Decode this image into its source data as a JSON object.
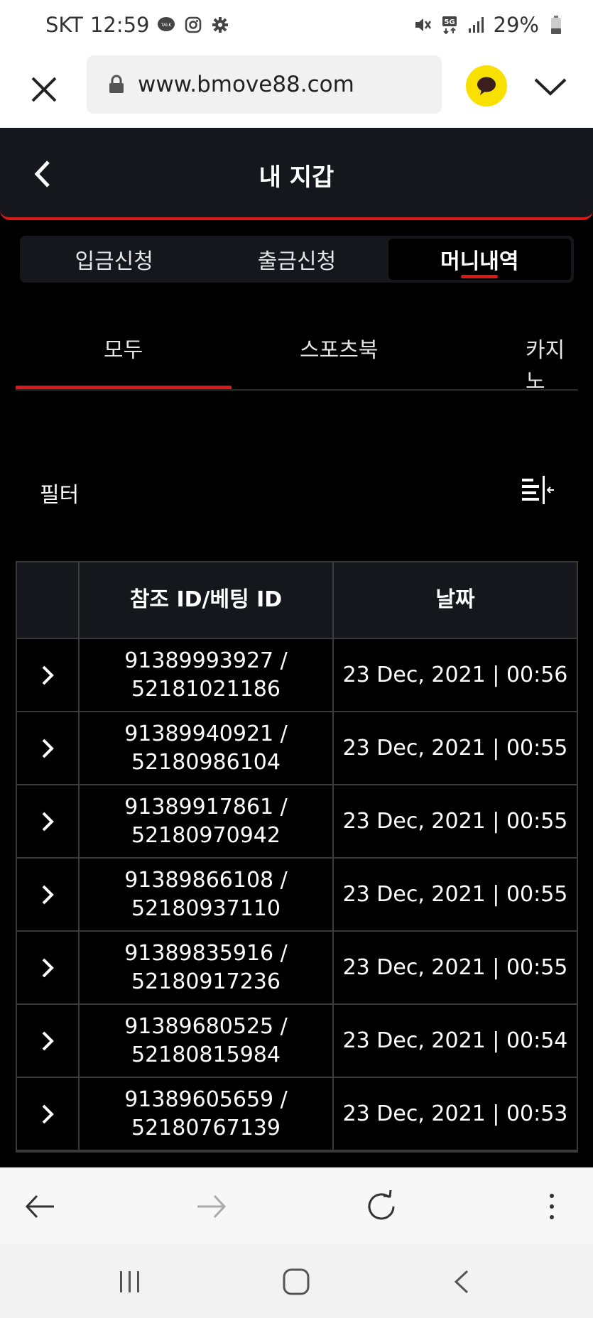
{
  "status_bar": {
    "carrier": "SKT",
    "time": "12:59",
    "network": "5G",
    "battery": "29%"
  },
  "browser": {
    "url": "www.bmove88.com"
  },
  "header": {
    "title": "내 지갑"
  },
  "segment_tabs": [
    {
      "label": "입금신청",
      "active": false
    },
    {
      "label": "출금신청",
      "active": false
    },
    {
      "label": "머니내역",
      "active": true
    }
  ],
  "category_tabs": [
    {
      "label": "모두",
      "active": true
    },
    {
      "label": "스포츠북",
      "active": false
    },
    {
      "label": "카지노",
      "active": false
    }
  ],
  "filter": {
    "label": "필터"
  },
  "table": {
    "columns": [
      "",
      "참조 ID/베팅 ID",
      "날짜"
    ],
    "rows": [
      {
        "ref_id": "91389993927 /",
        "bet_id": "52181021186",
        "date": "23 Dec, 2021 | 00:56"
      },
      {
        "ref_id": "91389940921 /",
        "bet_id": "52180986104",
        "date": "23 Dec, 2021 | 00:55"
      },
      {
        "ref_id": "91389917861 /",
        "bet_id": "52180970942",
        "date": "23 Dec, 2021 | 00:55"
      },
      {
        "ref_id": "91389866108 /",
        "bet_id": "52180937110",
        "date": "23 Dec, 2021 | 00:55"
      },
      {
        "ref_id": "91389835916 /",
        "bet_id": "52180917236",
        "date": "23 Dec, 2021 | 00:55"
      },
      {
        "ref_id": "91389680525 /",
        "bet_id": "52180815984",
        "date": "23 Dec, 2021 | 00:54"
      },
      {
        "ref_id": "91389605659 /",
        "bet_id": "52180767139",
        "date": "23 Dec, 2021 | 00:53"
      }
    ]
  },
  "colors": {
    "accent": "#d81a1a",
    "header_bg": "#16171d",
    "kakao_yellow": "#f8e000"
  }
}
